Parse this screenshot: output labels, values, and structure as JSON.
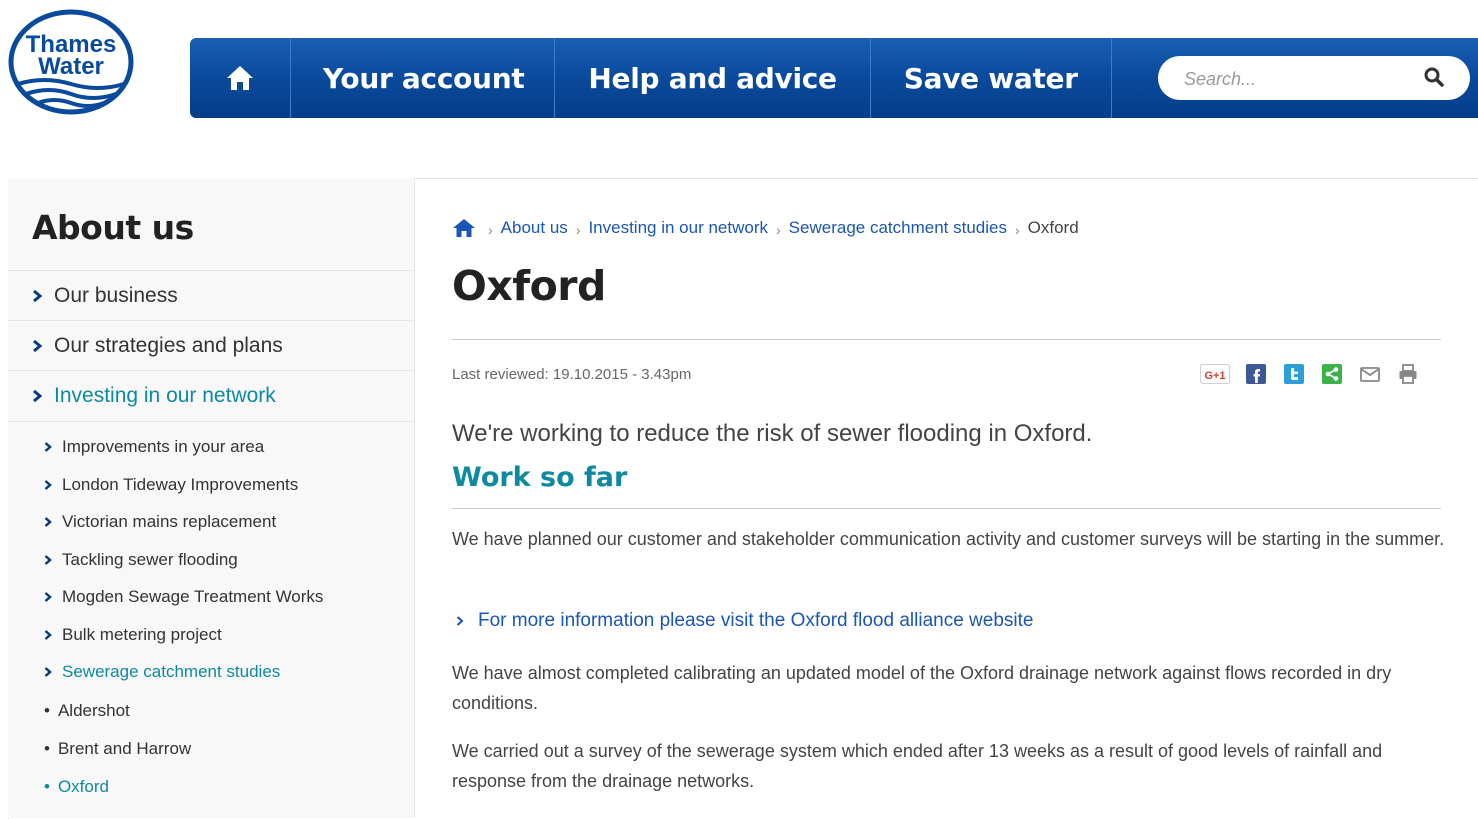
{
  "brand": {
    "logo_line1": "Thames",
    "logo_line2": "Water",
    "primary_color": "#0a4a9c",
    "accent_color": "#0d8aa0"
  },
  "nav": {
    "home_icon": "home-icon",
    "items": [
      {
        "label": "Your account"
      },
      {
        "label": "Help and advice"
      },
      {
        "label": "Save water"
      }
    ]
  },
  "search": {
    "placeholder": "Search...",
    "icon": "search-icon"
  },
  "sidebar": {
    "title": "About us",
    "items": [
      {
        "label": "Our business"
      },
      {
        "label": "Our strategies and plans"
      },
      {
        "label": "Investing in our network",
        "active": true
      }
    ],
    "subitems": [
      {
        "label": "Improvements in your area"
      },
      {
        "label": "London Tideway Improvements"
      },
      {
        "label": "Victorian mains replacement"
      },
      {
        "label": "Tackling sewer flooding"
      },
      {
        "label": "Mogden Sewage Treatment Works"
      },
      {
        "label": "Bulk metering project"
      },
      {
        "label": "Sewerage catchment studies",
        "active": true
      }
    ],
    "subsubitems": [
      {
        "label": "Aldershot"
      },
      {
        "label": "Brent and Harrow"
      },
      {
        "label": "Oxford",
        "active": true
      }
    ]
  },
  "breadcrumb": {
    "items": [
      "About us",
      "Investing in our network",
      "Sewerage catchment studies"
    ],
    "current": "Oxford"
  },
  "main": {
    "title": "Oxford",
    "last_reviewed": "Last reviewed: 19.10.2015 - 3.43pm",
    "share_icons": [
      "google-plus-icon",
      "facebook-icon",
      "twitter-icon",
      "share-icon",
      "email-icon",
      "print-icon"
    ],
    "gplus_label": "G+1",
    "lead": "We're working to reduce the risk of sewer flooding in Oxford.",
    "section_heading": "Work so far",
    "para1": "We have planned our customer and stakeholder communication activity and customer surveys will be starting in the summer.",
    "more_link": "For more information please visit the Oxford flood alliance website",
    "para2": "We have almost completed calibrating an updated model of the Oxford drainage network against flows recorded in dry conditions.",
    "para3": "We carried out a survey of the sewerage system which ended after 13 weeks as a result of good levels of rainfall and response from the drainage networks."
  }
}
